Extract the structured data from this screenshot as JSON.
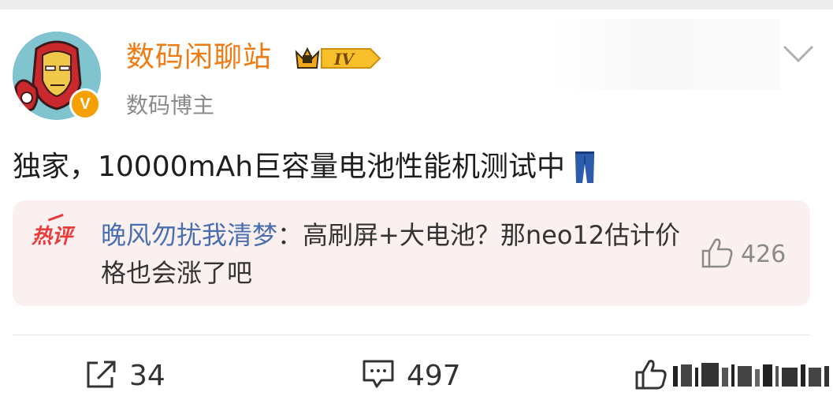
{
  "post": {
    "author_name": "数码闲聊站",
    "level_badge": "IV",
    "author_subtitle": "数码博主",
    "verified_mark": "V",
    "text": "独家，10000mAh巨容量电池性能机测试中",
    "text_emoji": "jeans-icon"
  },
  "hot_comment": {
    "tag": "热评",
    "commenter": "晚风勿扰我清梦",
    "separator": "：",
    "content": "高刷屏+大电池？那neo12估计价格也会涨了吧",
    "like_count": "426"
  },
  "actions": {
    "repost_count": "34",
    "comment_count": "497"
  },
  "colors": {
    "username": "#f07b12",
    "commenter": "#4a6fb1",
    "hot_tag": "#ea3b3b",
    "hot_box_bg": "#faf0f0",
    "verify_badge": "#f5a000"
  }
}
